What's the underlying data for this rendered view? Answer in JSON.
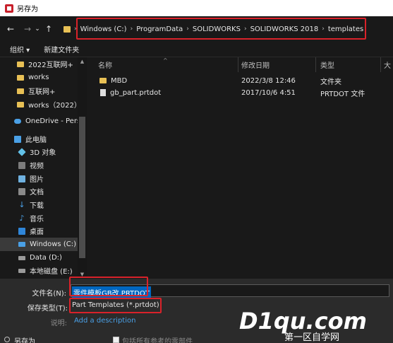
{
  "window": {
    "title": "另存为"
  },
  "nav": {
    "back": "←",
    "forward": "→",
    "dropdown": "⌄",
    "up": "↑"
  },
  "breadcrumbs": [
    "Windows (C:)",
    "ProgramData",
    "SOLIDWORKS",
    "SOLIDWORKS 2018",
    "templates"
  ],
  "toolbar": {
    "organize": "组织 ▾",
    "new_folder": "新建文件夹"
  },
  "sidebar": {
    "items": [
      {
        "label": "2022互联网+",
        "icon": "folder-icon"
      },
      {
        "label": "works",
        "icon": "folder-icon"
      },
      {
        "label": "互联网+",
        "icon": "folder-icon"
      },
      {
        "label": "works（2022）",
        "icon": "folder-icon"
      },
      {
        "label": "OneDrive - Perso",
        "icon": "cloud-icon"
      },
      {
        "label": "此电脑",
        "icon": "computer-icon"
      },
      {
        "label": "3D 对象",
        "icon": "cube-icon"
      },
      {
        "label": "视频",
        "icon": "video-icon"
      },
      {
        "label": "图片",
        "icon": "picture-icon"
      },
      {
        "label": "文档",
        "icon": "document-icon"
      },
      {
        "label": "下载",
        "icon": "download-icon"
      },
      {
        "label": "音乐",
        "icon": "music-icon"
      },
      {
        "label": "桌面",
        "icon": "desktop-icon"
      },
      {
        "label": "Windows (C:)",
        "icon": "windows-drive-icon"
      },
      {
        "label": "Data (D:)",
        "icon": "drive-icon"
      },
      {
        "label": "本地磁盘 (E:)",
        "icon": "drive-icon"
      }
    ]
  },
  "table": {
    "columns": [
      "名称",
      "修改日期",
      "类型",
      "大"
    ],
    "rows": [
      {
        "name": "MBD",
        "date": "2022/3/8 12:46",
        "type": "文件夹",
        "icon": "folder-icon"
      },
      {
        "name": "gb_part.prtdot",
        "date": "2017/10/6 4:51",
        "type": "PRTDOT 文件",
        "icon": "file-icon"
      }
    ]
  },
  "form": {
    "filename_label": "文件名(N):",
    "filename_value": "零件模板GB改.PRTDOT",
    "savetype_label": "保存类型(T):",
    "savetype_value": "Part Templates (*.prtdot)",
    "description_label": "说明:",
    "description_link": "Add a description"
  },
  "footer": {
    "save_as": "另存为",
    "checkbox_label": "包括所有参考的零部件"
  },
  "watermark": {
    "main": "D1qu.com",
    "sub": "第一区自学网"
  },
  "colors": {
    "highlight": "#d9222a",
    "selection": "#0067c0",
    "link": "#4aa0e6",
    "folder": "#e8c055"
  }
}
